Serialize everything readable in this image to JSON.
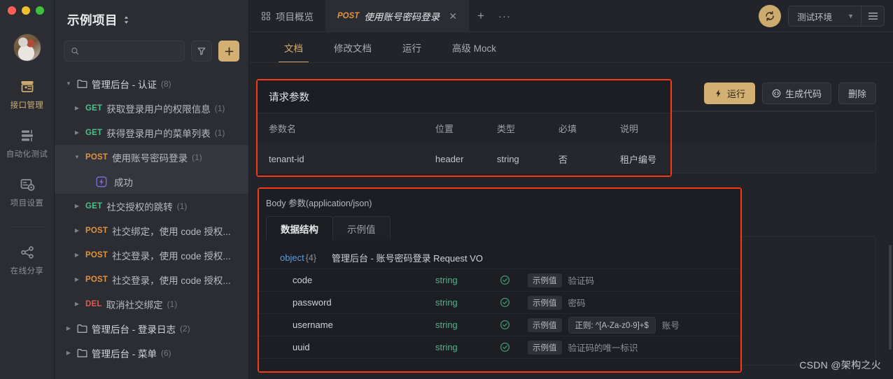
{
  "window": {
    "traffic_lights": [
      "close",
      "minimize",
      "maximize"
    ]
  },
  "rail": {
    "items": [
      {
        "label": "接口管理",
        "icon": "api-box-icon",
        "active": true
      },
      {
        "label": "自动化测试",
        "icon": "automation-test-icon",
        "active": false
      },
      {
        "label": "项目设置",
        "icon": "project-settings-icon",
        "active": false
      },
      {
        "label": "在线分享",
        "icon": "share-icon",
        "active": false
      }
    ]
  },
  "sidebar": {
    "project_name": "示例项目",
    "search_placeholder": "",
    "filter_label": "筛选",
    "add_label": "+",
    "tree": [
      {
        "type": "folder",
        "name": "管理后台 - 认证",
        "count": "(8)",
        "expanded": true
      },
      {
        "type": "api",
        "method": "GET",
        "label": "获取登录用户的权限信息",
        "count": "(1)"
      },
      {
        "type": "api",
        "method": "GET",
        "label": "获得登录用户的菜单列表",
        "count": "(1)"
      },
      {
        "type": "api",
        "method": "POST",
        "label": "使用账号密码登录",
        "count": "(1)",
        "selected": true,
        "expanded": true
      },
      {
        "type": "case",
        "label": "成功",
        "icon": "flash-case-icon",
        "selected": true
      },
      {
        "type": "api",
        "method": "GET",
        "label": "社交授权的跳转",
        "count": "(1)"
      },
      {
        "type": "api",
        "method": "POST",
        "label": "社交绑定，使用 code 授权...",
        "count": ""
      },
      {
        "type": "api",
        "method": "POST",
        "label": "社交登录，使用 code 授权...",
        "count": ""
      },
      {
        "type": "api",
        "method": "POST",
        "label": "社交登录，使用 code 授权...",
        "count": ""
      },
      {
        "type": "api",
        "method": "DEL",
        "label": "取消社交绑定",
        "count": "(1)"
      },
      {
        "type": "folder",
        "name": "管理后台 - 登录日志",
        "count": "(2)",
        "expanded": false
      },
      {
        "type": "folder",
        "name": "管理后台 - 菜单",
        "count": "(6)",
        "expanded": false
      }
    ]
  },
  "tabbar": {
    "tabs": [
      {
        "icon": "overview-grid-icon",
        "label": "项目概览",
        "active": false
      },
      {
        "method": "POST",
        "label": "使用账号密码登录",
        "active": true,
        "closable": true
      }
    ],
    "add_label": "+",
    "more_label": "···",
    "sync_icon": "sync-icon",
    "environment": "测试环境",
    "menu_icon": "hamburger-icon"
  },
  "subtabs": {
    "items": [
      {
        "label": "文档",
        "active": true
      },
      {
        "label": "修改文档",
        "active": false
      },
      {
        "label": "运行",
        "active": false
      },
      {
        "label": "高级 Mock",
        "active": false
      }
    ]
  },
  "actions": {
    "run": "运行",
    "generate_code": "生成代码",
    "delete": "删除"
  },
  "request_params": {
    "title": "请求参数",
    "columns": [
      "参数名",
      "位置",
      "类型",
      "必填",
      "说明"
    ],
    "rows": [
      {
        "name": "tenant-id",
        "position": "header",
        "type": "string",
        "required": "否",
        "desc": "租户编号"
      }
    ]
  },
  "body_params": {
    "label": "Body 参数(application/json)",
    "tabs": [
      {
        "label": "数据结构",
        "active": true
      },
      {
        "label": "示例值",
        "active": false
      }
    ],
    "root": {
      "type": "object",
      "count": "{4}",
      "name": "管理后台 - 账号密码登录 Request VO"
    },
    "fields": [
      {
        "key": "code",
        "type": "string",
        "check": "check-circle-icon",
        "chip": "示例值",
        "regex": "",
        "desc": "验证码"
      },
      {
        "key": "password",
        "type": "string",
        "check": "check-circle-icon",
        "chip": "示例值",
        "regex": "",
        "desc": "密码"
      },
      {
        "key": "username",
        "type": "string",
        "check": "check-circle-icon",
        "chip": "示例值",
        "regex": "正则: ^[A-Za-z0-9]+$",
        "desc": "账号"
      },
      {
        "key": "uuid",
        "type": "string",
        "check": "check-circle-icon",
        "chip": "示例值",
        "regex": "",
        "desc": "验证码的唯一标识"
      }
    ]
  },
  "watermark": "CSDN @架构之火",
  "colors": {
    "accent_gold": "#d2b074",
    "method_get": "#4ec08a",
    "method_post": "#e3933f",
    "method_del": "#e05a52",
    "type_string": "#4cb389",
    "highlight_red": "#f93a14",
    "background": "#232429",
    "panel": "#1d1e23"
  }
}
